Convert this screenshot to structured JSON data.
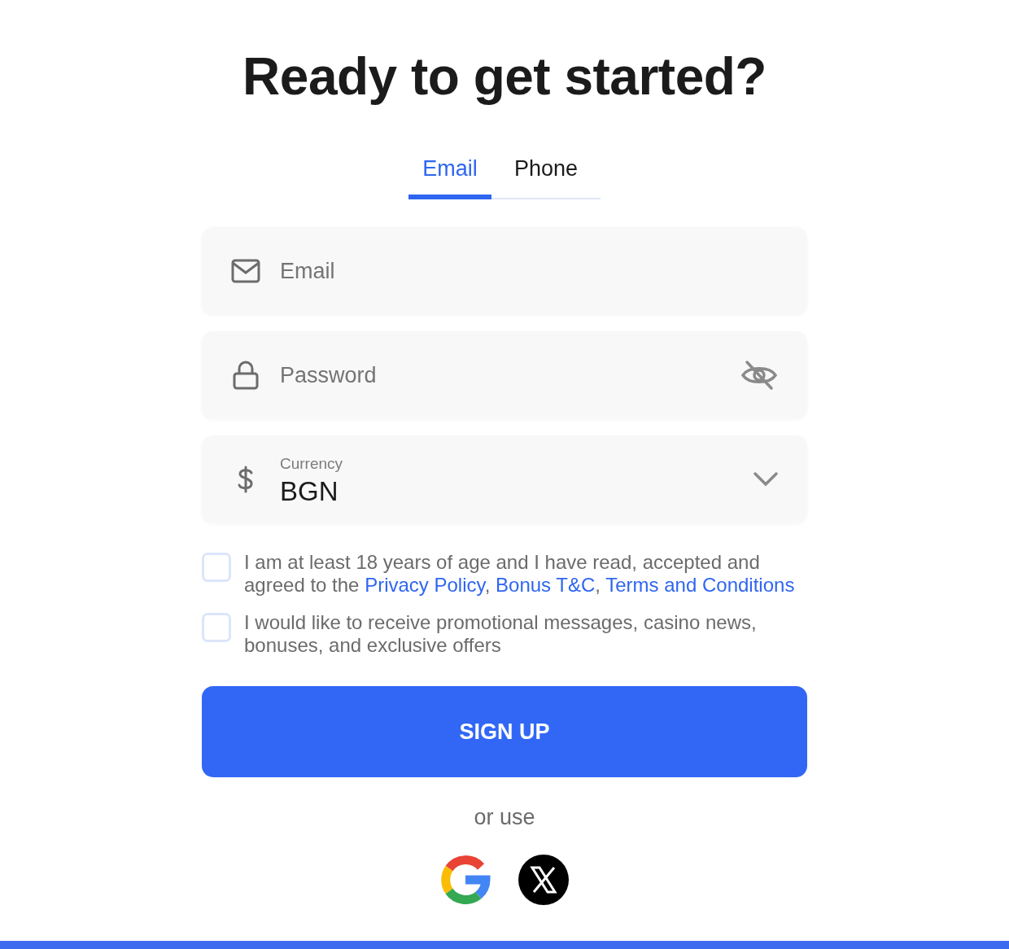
{
  "title": "Ready to get started?",
  "tabs": [
    {
      "label": "Email",
      "selected": true
    },
    {
      "label": "Phone",
      "selected": false
    }
  ],
  "fields": [
    {
      "kind": "email",
      "placeholder": "Email"
    },
    {
      "kind": "password",
      "placeholder": "Password",
      "revealed": false
    },
    {
      "kind": "select",
      "label": "Currency",
      "value": "BGN"
    }
  ],
  "consents": [
    {
      "checked": false,
      "parts": [
        {
          "kind": "text",
          "text": "I am at least 18 years of age and I have read, accepted and agreed to the "
        },
        {
          "kind": "link",
          "text": "Privacy Policy"
        },
        {
          "kind": "text",
          "text": ", "
        },
        {
          "kind": "link",
          "text": "Bonus T&C"
        },
        {
          "kind": "text",
          "text": ", "
        },
        {
          "kind": "link",
          "text": "Terms and Conditions"
        }
      ]
    },
    {
      "checked": false,
      "parts": [
        {
          "kind": "text",
          "text": "I would like to receive promotional messages, casino news, bonuses, and exclusive offers"
        }
      ]
    }
  ],
  "submit": "SIGN UP",
  "alt_label": "or use",
  "social": [
    {
      "kind": "google"
    },
    {
      "kind": "x"
    }
  ]
}
